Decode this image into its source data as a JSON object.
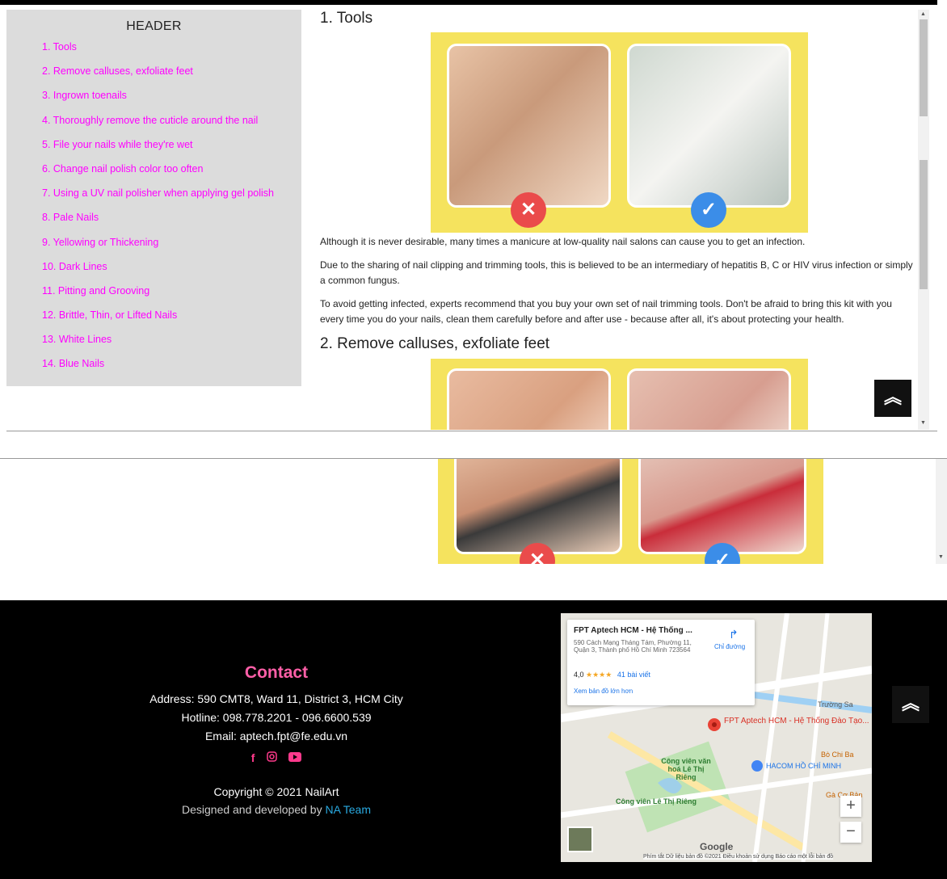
{
  "sidebar": {
    "title": "HEADER",
    "items": [
      "1. Tools",
      "2. Remove calluses, exfoliate feet",
      "3. Ingrown toenails",
      "4. Thoroughly remove the cuticle around the nail",
      "5. File your nails while they're wet",
      "6. Change nail polish color too often",
      "7. Using a UV nail polisher when applying gel polish",
      "8. Pale Nails",
      "9. Yellowing or Thickening",
      "10. Dark Lines",
      "11. Pitting and Grooving",
      "12. Brittle, Thin, or Lifted Nails",
      "13. White Lines",
      "14. Blue Nails"
    ],
    "link_color": "#ff00ff"
  },
  "article": {
    "section1_title": "1. Tools",
    "section1_paragraphs": [
      "Although it is never desirable, many times a manicure at low-quality nail salons can cause you to get an infection.",
      "Due to the sharing of nail clipping and trimming tools, this is believed to be an intermediary of hepatitis B, C or HIV virus infection or simply a common fungus.",
      "To avoid getting infected, experts recommend that you buy your own set of nail trimming tools. Don't be afraid to bring this kit with you every time you do your nails, clean them carefully before and after use - because after all, it's about protecting your health."
    ],
    "section2_title": "2. Remove calluses, exfoliate feet",
    "image_badges": {
      "wrong": "✕",
      "right": "✓"
    }
  },
  "scroll_top_icon": "double-chevron-up-icon",
  "scroll_top_glyph": "︽",
  "footer": {
    "contact_title": "Contact",
    "address": "Address: 590 CMT8, Ward 11, District 3, HCM City",
    "hotline": "Hotline: 098.778.2201 - 096.6600.539",
    "email": "Email: aptech.fpt@fe.edu.vn",
    "social_icons": [
      "facebook-icon",
      "instagram-icon",
      "youtube-icon"
    ],
    "copyright": "Copyright © 2021 NailArt",
    "designed_prefix": "Designed and developed by ",
    "designed_team": "NA Team",
    "contact_color": "#ff5fa8"
  },
  "map": {
    "place_name": "FPT Aptech HCM - Hệ Thống ...",
    "address": "590 Cách Mạng Tháng Tám, Phường 11, Quận 3, Thành phố Hồ Chí Minh 723564",
    "rating": "4,0",
    "stars": "★★★★",
    "reviews": "41 bài viết",
    "directions": "Chỉ đường",
    "bigger_map": "Xem bản đồ lớn hơn",
    "pin_label": "FPT Aptech HCM - Hệ Thống Đào Tạo...",
    "park_label_1": "Công viên văn hoá Lê Thị Riêng",
    "park_label_2": "Công viên Lê Thị Riêng",
    "hacom_label": "HACOM HỒ CHÍ MINH",
    "street_truong_sa": "Trường Sa",
    "bo_chi_ba": "Bò Chi Ba",
    "ga_co_ban": "Gà Cơ Bản",
    "zoom_in": "+",
    "zoom_out": "−",
    "google": "Google",
    "attribution": "Phím tắt   Dữ liệu bản đồ ©2021   Điều khoản sử dụng   Báo cáo một lỗi bản đồ"
  }
}
